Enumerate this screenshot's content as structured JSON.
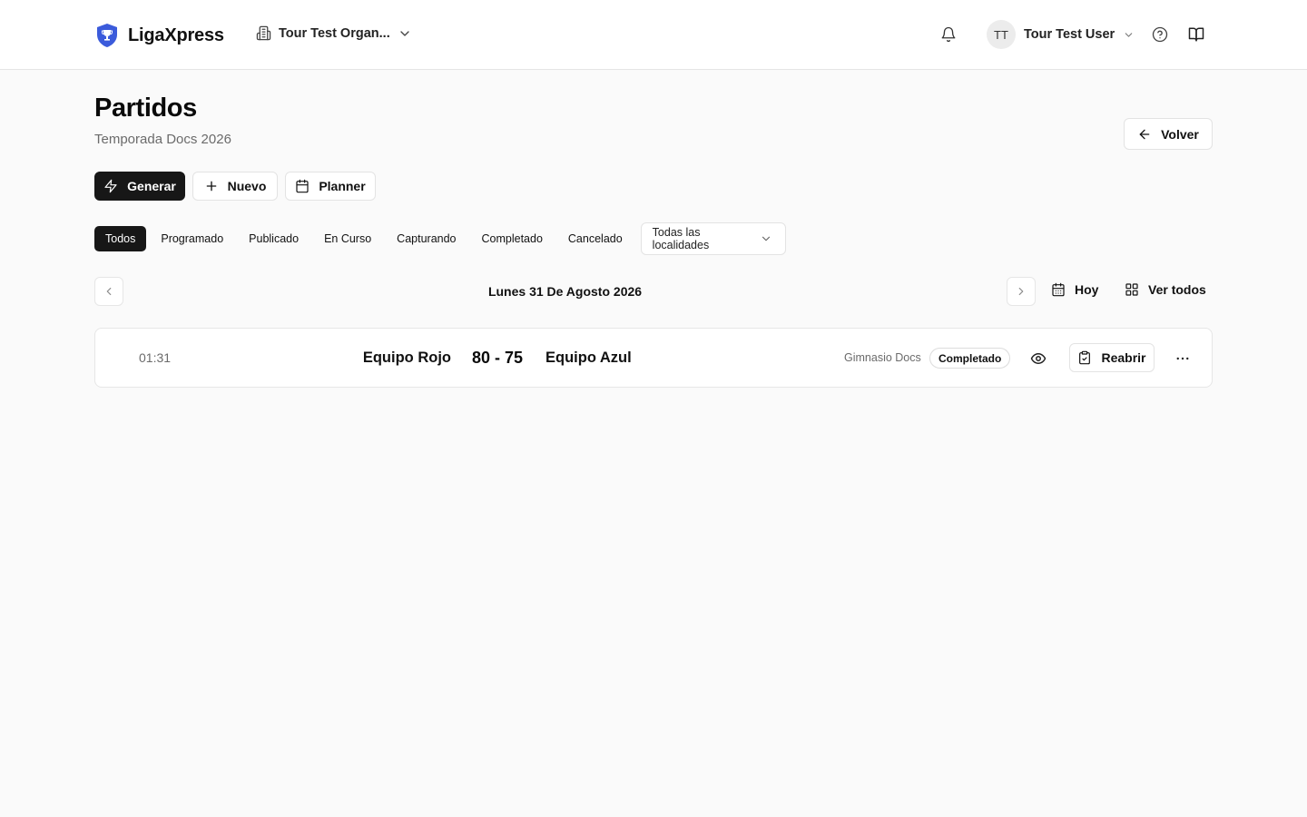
{
  "header": {
    "brand": "LigaXpress",
    "organization": "Tour Test Organ...",
    "user_initials": "TT",
    "user_name": "Tour Test User"
  },
  "page": {
    "title": "Partidos",
    "subtitle": "Temporada Docs 2026",
    "back_label": "Volver"
  },
  "actions": {
    "generate": "Generar",
    "new": "Nuevo",
    "planner": "Planner"
  },
  "filters": {
    "tabs": [
      "Todos",
      "Programado",
      "Publicado",
      "En Curso",
      "Capturando",
      "Completado",
      "Cancelado"
    ],
    "active": "Todos",
    "location": "Todas las localidades"
  },
  "date_nav": {
    "date": "Lunes 31 De Agosto 2026",
    "today": "Hoy",
    "view_all": "Ver todos"
  },
  "matches": [
    {
      "time": "01:31",
      "home": "Equipo Rojo",
      "score": "80 - 75",
      "away": "Equipo Azul",
      "venue": "Gimnasio Docs",
      "status": "Completado",
      "reopen": "Reabrir"
    }
  ],
  "colors": {
    "primary": "#171717",
    "brand_shield": "#3b5bdb",
    "background": "#fafafa"
  }
}
